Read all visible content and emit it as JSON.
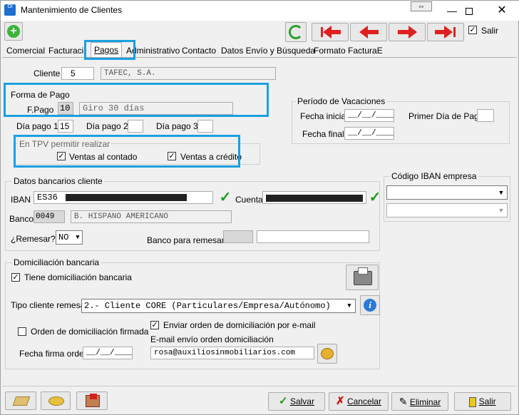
{
  "window": {
    "title": "Mantenimiento de Clientes",
    "app_icon": "Ol"
  },
  "toolbar": {
    "salir_label": "Salir"
  },
  "tabs": [
    "Comercial",
    "Facturación",
    "Pagos",
    "Administrativo",
    "Contacto",
    "Datos Envío y Búsqueda",
    "Formato FacturaE"
  ],
  "cliente": {
    "label": "Cliente",
    "code": "5",
    "name": "TAFEC, S.A."
  },
  "forma_pago": {
    "group_label": "Forma de Pago",
    "label": "F.Pago",
    "code": "10",
    "description": "Giro 30 días"
  },
  "dias_pago": {
    "dia1_label": "Día pago 1",
    "dia1": "15",
    "dia2_label": "Día pago 2",
    "dia2": "",
    "dia3_label": "Día pago 3",
    "dia3": ""
  },
  "tpv": {
    "group_label": "En TPV permitir realizar",
    "contado_label": "Ventas al contado",
    "credito_label": "Ventas a crédito"
  },
  "vacaciones": {
    "group_label": "Período de Vacaciones",
    "fecha_inicial_label": "Fecha inicial",
    "fecha_inicial": "__/__/____",
    "fecha_final_label": "Fecha final",
    "fecha_final": "__/__/____",
    "primer_dia_label": "Primer Día de Pago",
    "primer_dia": ""
  },
  "bancarios": {
    "group_label": "Datos bancarios cliente",
    "iban_label": "IBAN",
    "iban_prefix": "ES36",
    "cuenta_label": "Cuenta",
    "banco_label": "Banco",
    "banco_code": "0049",
    "banco_name": "B. HISPANO AMERICANO",
    "remesar_label": "¿Remesar?",
    "remesar_value": "NO",
    "banco_remesar_label": "Banco para remesar"
  },
  "iban_empresa": {
    "group_label": "Código IBAN empresa"
  },
  "domiciliacion": {
    "group_label": "Domiciliación bancaria",
    "tiene_label": "Tiene domiciliación bancaria",
    "tipo_label": "Tipo cliente remesa",
    "tipo_value": "2.-  Cliente CORE (Particulares/Empresa/Autónomo)",
    "orden_firmada_label": "Orden de domiciliación firmada",
    "enviar_email_label": "Enviar orden de domiciliación por e-mail",
    "email_label": "E-mail envío orden domiciliación",
    "email_value": "rosa@auxiliosinmobiliarios.com",
    "fecha_firma_label": "Fecha firma orden",
    "fecha_firma": "__/__/____"
  },
  "bottom": {
    "salvar": "Salvar",
    "cancelar": "Cancelar",
    "eliminar": "Eliminar",
    "salir": "Salir"
  }
}
